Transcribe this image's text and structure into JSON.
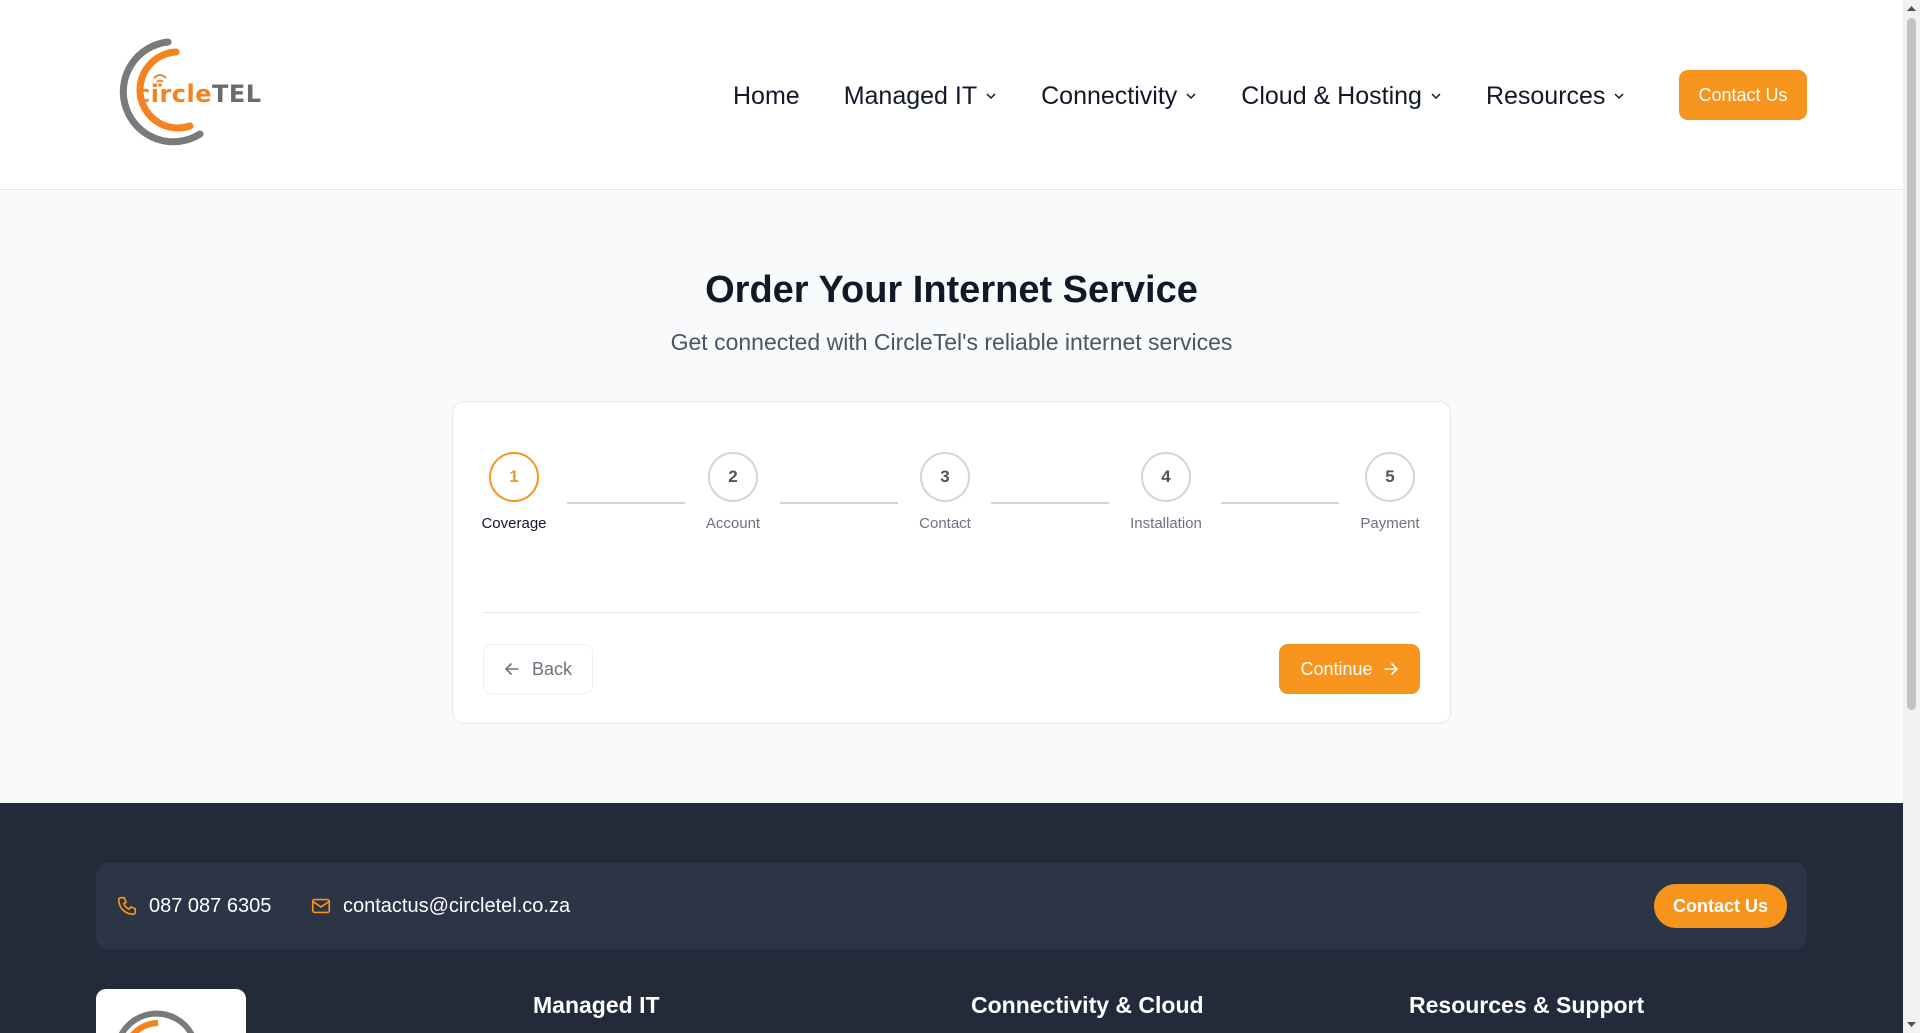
{
  "header": {
    "logo": {
      "text_primary": "circle",
      "text_secondary": "TEL"
    },
    "nav": [
      {
        "label": "Home",
        "has_dropdown": false
      },
      {
        "label": "Managed IT",
        "has_dropdown": true
      },
      {
        "label": "Connectivity",
        "has_dropdown": true
      },
      {
        "label": "Cloud & Hosting",
        "has_dropdown": true
      },
      {
        "label": "Resources",
        "has_dropdown": true
      }
    ],
    "cta_label": "Contact Us"
  },
  "main": {
    "title": "Order Your Internet Service",
    "subtitle": "Get connected with CircleTel's reliable internet services",
    "steps": [
      {
        "number": "1",
        "label": "Coverage",
        "active": true
      },
      {
        "number": "2",
        "label": "Account",
        "active": false
      },
      {
        "number": "3",
        "label": "Contact",
        "active": false
      },
      {
        "number": "4",
        "label": "Installation",
        "active": false
      },
      {
        "number": "5",
        "label": "Payment",
        "active": false
      }
    ],
    "back_label": "Back",
    "continue_label": "Continue"
  },
  "footer": {
    "phone": "087 087 6305",
    "email": "contactus@circletel.co.za",
    "contact_button": "Contact Us",
    "columns": [
      "Managed IT",
      "Connectivity & Cloud",
      "Resources & Support"
    ]
  },
  "colors": {
    "accent": "#f7941d",
    "footer_bg": "#232b3a",
    "main_bg": "#f9fafb"
  }
}
